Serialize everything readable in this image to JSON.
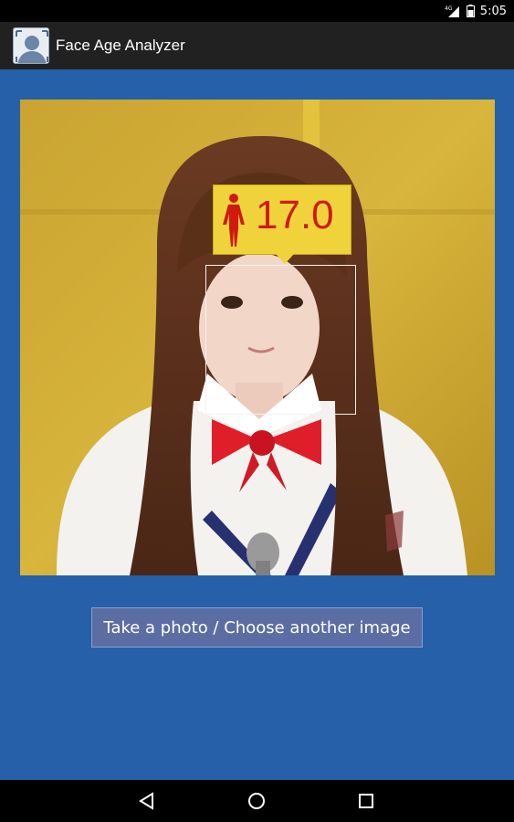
{
  "status_bar": {
    "time": "5:05",
    "network_label": "4G",
    "icons": [
      "signal-icon",
      "battery-icon"
    ]
  },
  "action_bar": {
    "title": "Face Age Analyzer",
    "icon": "app-face-icon"
  },
  "result": {
    "age": "17.0",
    "gender_icon": "female-icon",
    "label_color": "#f0d33a",
    "age_color": "#d01a10"
  },
  "main": {
    "button_label": "Take a photo / Choose another image",
    "background_color": "#2560a8"
  },
  "nav_bar": {
    "buttons": [
      "back-icon",
      "home-icon",
      "recents-icon"
    ]
  }
}
